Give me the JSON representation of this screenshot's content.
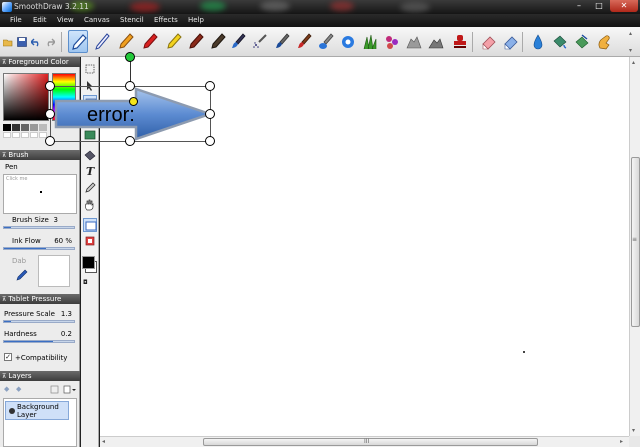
{
  "window": {
    "title": "SmoothDraw 3.2.11",
    "minimize": "–",
    "maximize": "□",
    "close": "✕"
  },
  "menu": [
    "File",
    "Edit",
    "View",
    "Canvas",
    "Stencil",
    "Effects",
    "Help"
  ],
  "panel": {
    "foreground_color": {
      "header": "Foreground Color"
    },
    "brush": {
      "header": "Brush",
      "name": "Pen",
      "preview_hint": "Click me"
    },
    "brush_size": {
      "label": "Brush Size",
      "value": "3",
      "fill_fraction": 0.1
    },
    "ink_flow": {
      "label": "Ink Flow",
      "value": "60 %",
      "fill_fraction": 0.6
    },
    "dab": {
      "label": "Dab"
    },
    "tablet_pressure": {
      "header": "Tablet Pressure"
    },
    "pressure_scale": {
      "label": "Pressure Scale",
      "value": "1.3",
      "fill_fraction": 0.1
    },
    "hardness": {
      "label": "Hardness",
      "value": "0.2",
      "fill_fraction": 0.7
    },
    "compatibility": {
      "label": "+Compatibility",
      "checked": true
    },
    "layers": {
      "header": "Layers",
      "items": [
        {
          "name": "Background\nLayer"
        }
      ]
    }
  },
  "canvas": {
    "stencil_text": "error:",
    "hscroll_label": "III",
    "vscroll_label": "≡"
  },
  "colors": {
    "foreground": "#000000",
    "background": "#ffffff",
    "accent": "#3a6fc4"
  }
}
